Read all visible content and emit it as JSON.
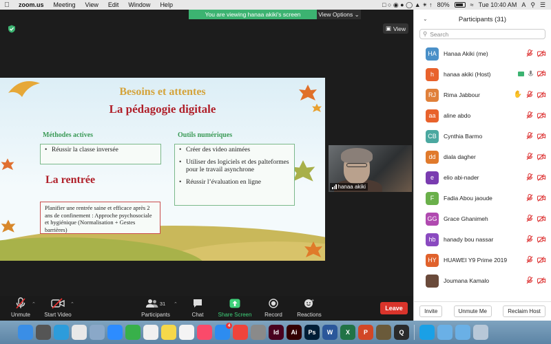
{
  "menubar": {
    "app": "zoom.us",
    "menus": [
      "Meeting",
      "View",
      "Edit",
      "Window",
      "Help"
    ],
    "battery": "80%",
    "clock": "Tue 10:40 AM",
    "input_source": "A"
  },
  "banner": {
    "message": "You are viewing hanaa akiki's screen",
    "view_options": "View Options"
  },
  "view_button": "View",
  "slide": {
    "title": "Besoins et attentes",
    "subtitle": "La pédagogie digitale",
    "left_heading": "Méthodes actives",
    "left_items": [
      "Réussir la classe inversée"
    ],
    "right_heading": "Outils numériques",
    "right_items": [
      "Créer des video animées",
      "Utiliser des logiciels et des palteformes pour le travail asynchrone",
      "Réussir l’évaluation en ligne"
    ],
    "rentree_heading": "La rentrée",
    "rentree_text": "Planifier une rentrée saine  et efficace après 2 ans de confinement : Approche psychosociale et hygiénique (Normalisation + Gestes barrières)"
  },
  "video": {
    "name": "hanaa akiki"
  },
  "toolbar": {
    "unmute": "Unmute",
    "start_video": "Start Video",
    "participants": "Participants",
    "participants_count": "31",
    "chat": "Chat",
    "share_screen": "Share Screen",
    "record": "Record",
    "reactions": "Reactions",
    "leave": "Leave"
  },
  "panel": {
    "title": "Participants (31)",
    "search_placeholder": "Search",
    "participants": [
      {
        "initials": "HA",
        "name": "Hanaa Akiki (me)",
        "color": "#4a90c8"
      },
      {
        "initials": "h",
        "name": "hanaa akiki (Host)",
        "color": "#e8622c"
      },
      {
        "initials": "RJ",
        "name": "Rima Jabbour",
        "color": "#e0803a"
      },
      {
        "initials": "aa",
        "name": "aline abdo",
        "color": "#e8622c"
      },
      {
        "initials": "CB",
        "name": "Cynthia Barmo",
        "color": "#4aa8a0"
      },
      {
        "initials": "dd",
        "name": "diala dagher",
        "color": "#e07a2c"
      },
      {
        "initials": "e",
        "name": "elio abi-nader",
        "color": "#7a3cb0"
      },
      {
        "initials": "F",
        "name": "Fadia Abou jaoude",
        "color": "#6ab04a"
      },
      {
        "initials": "GG",
        "name": "Grace Ghanimeh",
        "color": "#b04ab0"
      },
      {
        "initials": "hb",
        "name": "hanady bou nassar",
        "color": "#8a4ac0"
      },
      {
        "initials": "HY",
        "name": "HUAWEI Y9 Prime 2019",
        "color": "#e0622c"
      },
      {
        "initials": "",
        "name": "Joumana Kamalo",
        "color": "#6a4a3a"
      }
    ],
    "invite": "Invite",
    "unmute_me": "Unmute Me",
    "reclaim_host": "Reclaim Host"
  },
  "dock": {
    "apps": [
      {
        "name": "finder",
        "color": "#3a8ee6"
      },
      {
        "name": "launchpad",
        "color": "#555"
      },
      {
        "name": "safari",
        "color": "#2d9cdb"
      },
      {
        "name": "chrome",
        "color": "#e8e8e8"
      },
      {
        "name": "preview",
        "color": "#8aa8c8"
      },
      {
        "name": "zoom",
        "color": "#2d8cff"
      },
      {
        "name": "facetime",
        "color": "#38b04a"
      },
      {
        "name": "photos",
        "color": "#f0f0f0"
      },
      {
        "name": "notes",
        "color": "#f5d84a"
      },
      {
        "name": "reminders",
        "color": "#f4f4f4"
      },
      {
        "name": "music",
        "color": "#fa4a6a"
      },
      {
        "name": "app-store",
        "color": "#2d8cf0",
        "badge": "4"
      },
      {
        "name": "anydesk",
        "color": "#ef443b"
      },
      {
        "name": "system-preferences",
        "color": "#8a8a8a"
      },
      {
        "name": "indesign",
        "color": "#49021f",
        "label": "Id"
      },
      {
        "name": "illustrator",
        "color": "#330000",
        "label": "Ai"
      },
      {
        "name": "photoshop",
        "color": "#001e36",
        "label": "Ps"
      },
      {
        "name": "word",
        "color": "#2b579a",
        "label": "W"
      },
      {
        "name": "excel",
        "color": "#217346",
        "label": "X"
      },
      {
        "name": "powerpoint",
        "color": "#d24726",
        "label": "P"
      },
      {
        "name": "game",
        "color": "#6a5a3a"
      },
      {
        "name": "quicktime",
        "color": "#2a2a2a",
        "label": "Q"
      },
      {
        "name": "accessibility",
        "color": "#1aa0e6"
      },
      {
        "name": "folder",
        "color": "#6ab0e6"
      },
      {
        "name": "downloads",
        "color": "#6ab0e6"
      },
      {
        "name": "trash",
        "color": "#b8c8d8"
      }
    ]
  }
}
